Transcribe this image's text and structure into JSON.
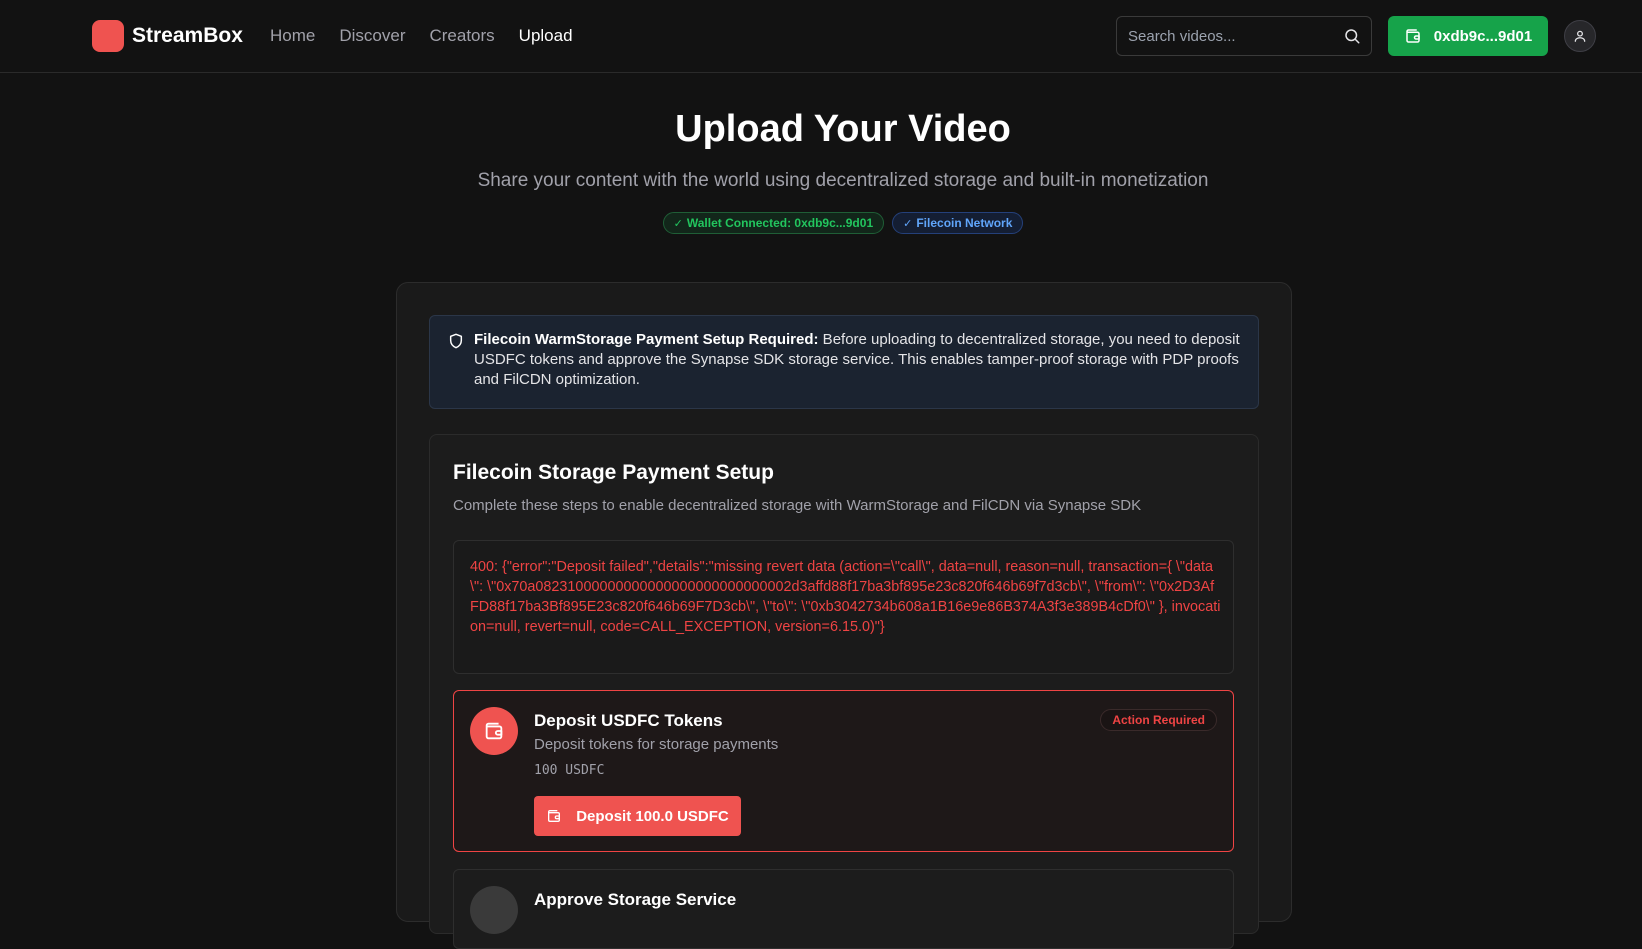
{
  "header": {
    "brand": "StreamBox",
    "nav": [
      {
        "label": "Home",
        "active": false
      },
      {
        "label": "Discover",
        "active": false
      },
      {
        "label": "Creators",
        "active": false
      },
      {
        "label": "Upload",
        "active": true
      }
    ],
    "search_placeholder": "Search videos...",
    "wallet_label": "0xdb9c...9d01",
    "brand_color": "#ef5350",
    "wallet_color": "#16a34a"
  },
  "hero": {
    "title": "Upload Your Video",
    "subtitle": "Share your content with the world using decentralized storage and built-in monetization",
    "badge_wallet": "Wallet Connected: 0xdb9c...9d01",
    "badge_network": "Filecoin Network",
    "badge_check": "✓"
  },
  "alert": {
    "bold": "Filecoin WarmStorage Payment Setup Required:",
    "text": " Before uploading to decentralized storage, you need to deposit USDFC tokens and approve the Synapse SDK storage service. This enables tamper-proof storage with PDP proofs and FilCDN optimization.",
    "icon": "shield-icon"
  },
  "setup": {
    "title": "Filecoin Storage Payment Setup",
    "description": "Complete these steps to enable decentralized storage with WarmStorage and FilCDN via Synapse SDK",
    "error": "400: {\"error\":\"Deposit failed\",\"details\":\"missing revert data (action=\\\"call\\\", data=null, reason=null, transaction={ \\\"data\\\": \\\"0x70a08231000000000000000000000000002d3affd88f17ba3bf895e23c820f646b69f7d3cb\\\", \\\"from\\\": \\\"0x2D3AfFD88f17ba3Bf895E23c820f646b69F7D3cb\\\", \\\"to\\\": \\\"0xb3042734b608a1B16e9e86B374A3f3e389B4cDf0\\\" }, invocation=null, revert=null, code=CALL_EXCEPTION, version=6.15.0)\"}",
    "steps": [
      {
        "title": "Deposit USDFC Tokens",
        "description": "Deposit tokens for storage payments",
        "amount": "100 USDFC",
        "status": "Action Required",
        "button": "Deposit 100.0 USDFC",
        "icon": "wallet-icon"
      },
      {
        "title": "Approve Storage Service"
      }
    ]
  }
}
